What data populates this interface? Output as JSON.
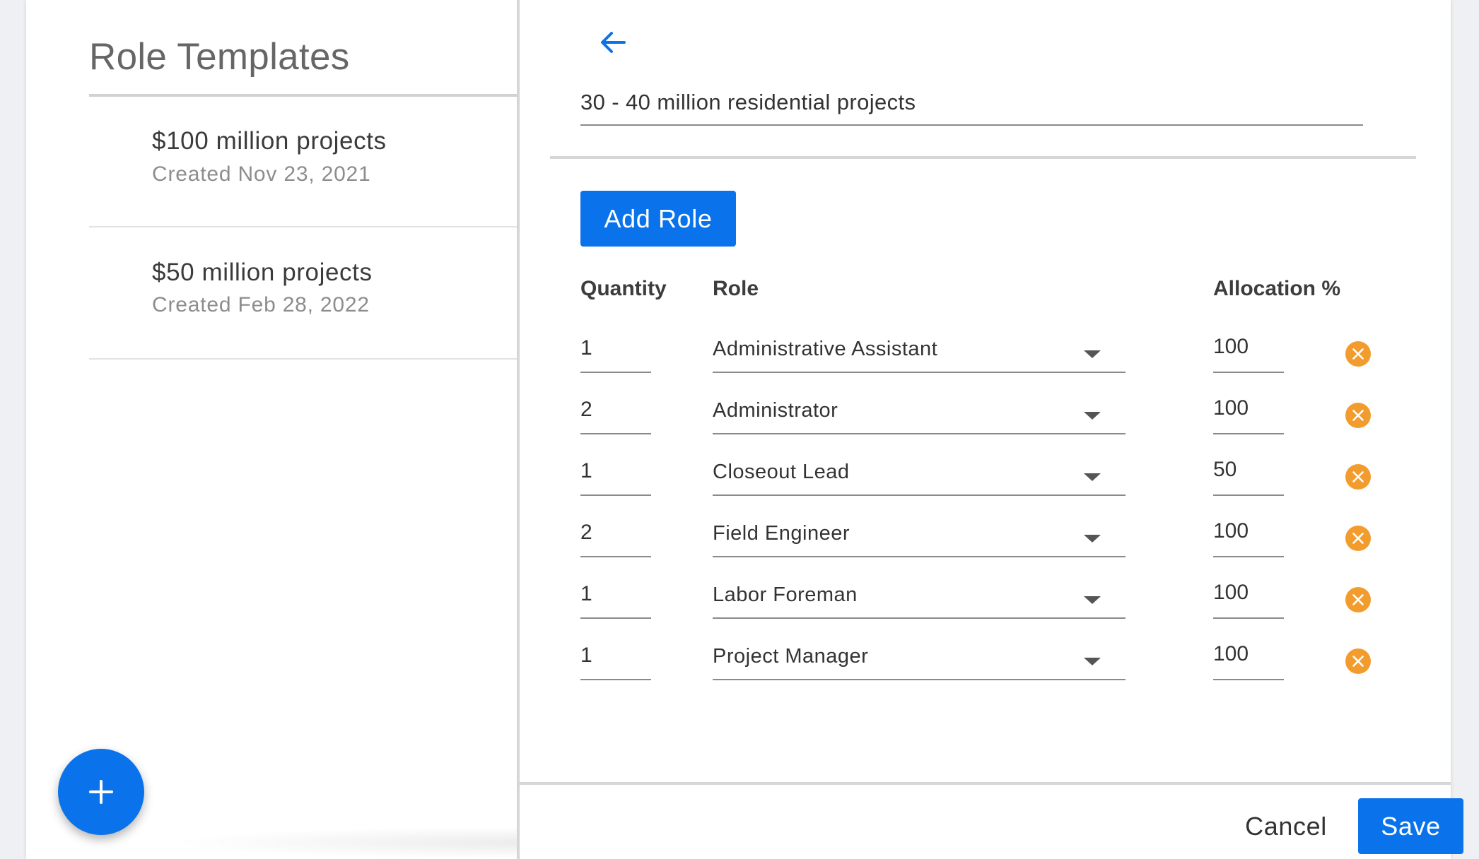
{
  "sidebar": {
    "title": "Role Templates",
    "templates": [
      {
        "name": "$100 million projects",
        "created": "Created Nov 23, 2021"
      },
      {
        "name": "$50 million projects",
        "created": "Created Feb 28, 2022"
      }
    ],
    "add_icon": "plus-icon"
  },
  "editor": {
    "back_icon": "arrow-left-icon",
    "template_name": "30 - 40 million residential projects",
    "add_role_label": "Add Role",
    "columns": {
      "quantity": "Quantity",
      "role": "Role",
      "allocation": "Allocation %"
    },
    "rows": [
      {
        "quantity": "1",
        "role": "Administrative Assistant",
        "allocation": "100"
      },
      {
        "quantity": "2",
        "role": "Administrator",
        "allocation": "100"
      },
      {
        "quantity": "1",
        "role": "Closeout Lead",
        "allocation": "50"
      },
      {
        "quantity": "2",
        "role": "Field Engineer",
        "allocation": "100"
      },
      {
        "quantity": "1",
        "role": "Labor Foreman",
        "allocation": "100"
      },
      {
        "quantity": "1",
        "role": "Project Manager",
        "allocation": "100"
      }
    ],
    "remove_icon": "close-circle-icon",
    "cancel_label": "Cancel",
    "save_label": "Save"
  },
  "colors": {
    "primary": "#0a73eb",
    "remove": "#f39c2e",
    "background": "#eef0f3"
  }
}
